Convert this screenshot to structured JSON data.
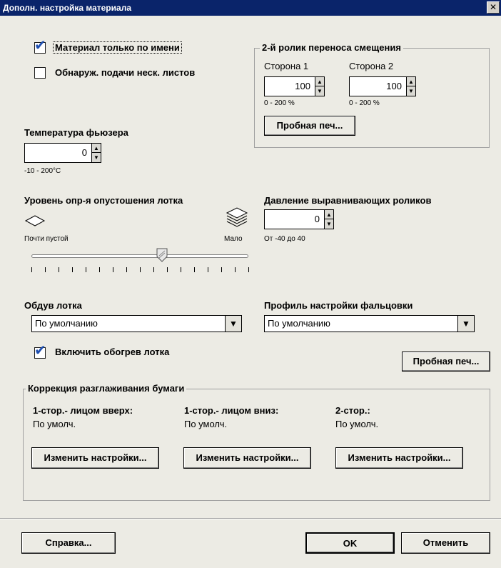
{
  "window": {
    "title": "Дополн. настройка материала",
    "close": "✕"
  },
  "options": {
    "name_only": {
      "label": "Материал только по имени",
      "checked": true
    },
    "multi_feed": {
      "label": "Обнаруж. подачи неск. листов",
      "checked": false
    }
  },
  "offset_roller": {
    "title": "2-й ролик переноса смещения",
    "side1": {
      "label": "Сторона 1",
      "value": "100",
      "range": "0 - 200 %"
    },
    "side2": {
      "label": "Сторона 2",
      "value": "100",
      "range": "0 - 200 %"
    },
    "test_print": "Пробная печ..."
  },
  "fuser": {
    "label": "Температура фьюзера",
    "value": "0",
    "range": "-10 - 200°C"
  },
  "tray_empty": {
    "label": "Уровень опр-я опустошения лотка",
    "left": "Почти пустой",
    "right": "Мало",
    "slider_level": 0.5
  },
  "align_pressure": {
    "label": "Давление выравнивающих роликов",
    "value": "0",
    "range": "От -40 до 40"
  },
  "tray_blow": {
    "label": "Обдув лотка",
    "value": "По умолчанию"
  },
  "fold_profile": {
    "label": "Профиль настройки фальцовки",
    "value": "По умолчанию"
  },
  "tray_heat": {
    "label": "Включить обогрев лотка",
    "checked": true
  },
  "test_print2": "Пробная печ...",
  "curl": {
    "title": "Коррекция разглаживания бумаги",
    "cols": [
      {
        "head": "1-стор.- лицом вверх:",
        "value": "По умолч.",
        "button": "Изменить настройки..."
      },
      {
        "head": "1-стор.- лицом вниз:",
        "value": "По умолч.",
        "button": "Изменить настройки..."
      },
      {
        "head": "2-стор.:",
        "value": "По умолч.",
        "button": "Изменить настройки..."
      }
    ]
  },
  "footer": {
    "help": "Справка...",
    "ok": "OK",
    "cancel": "Отменить"
  },
  "colors": {
    "titlebar": "#0a246a",
    "background": "#ecebe4",
    "check": "#1f4fb0"
  }
}
